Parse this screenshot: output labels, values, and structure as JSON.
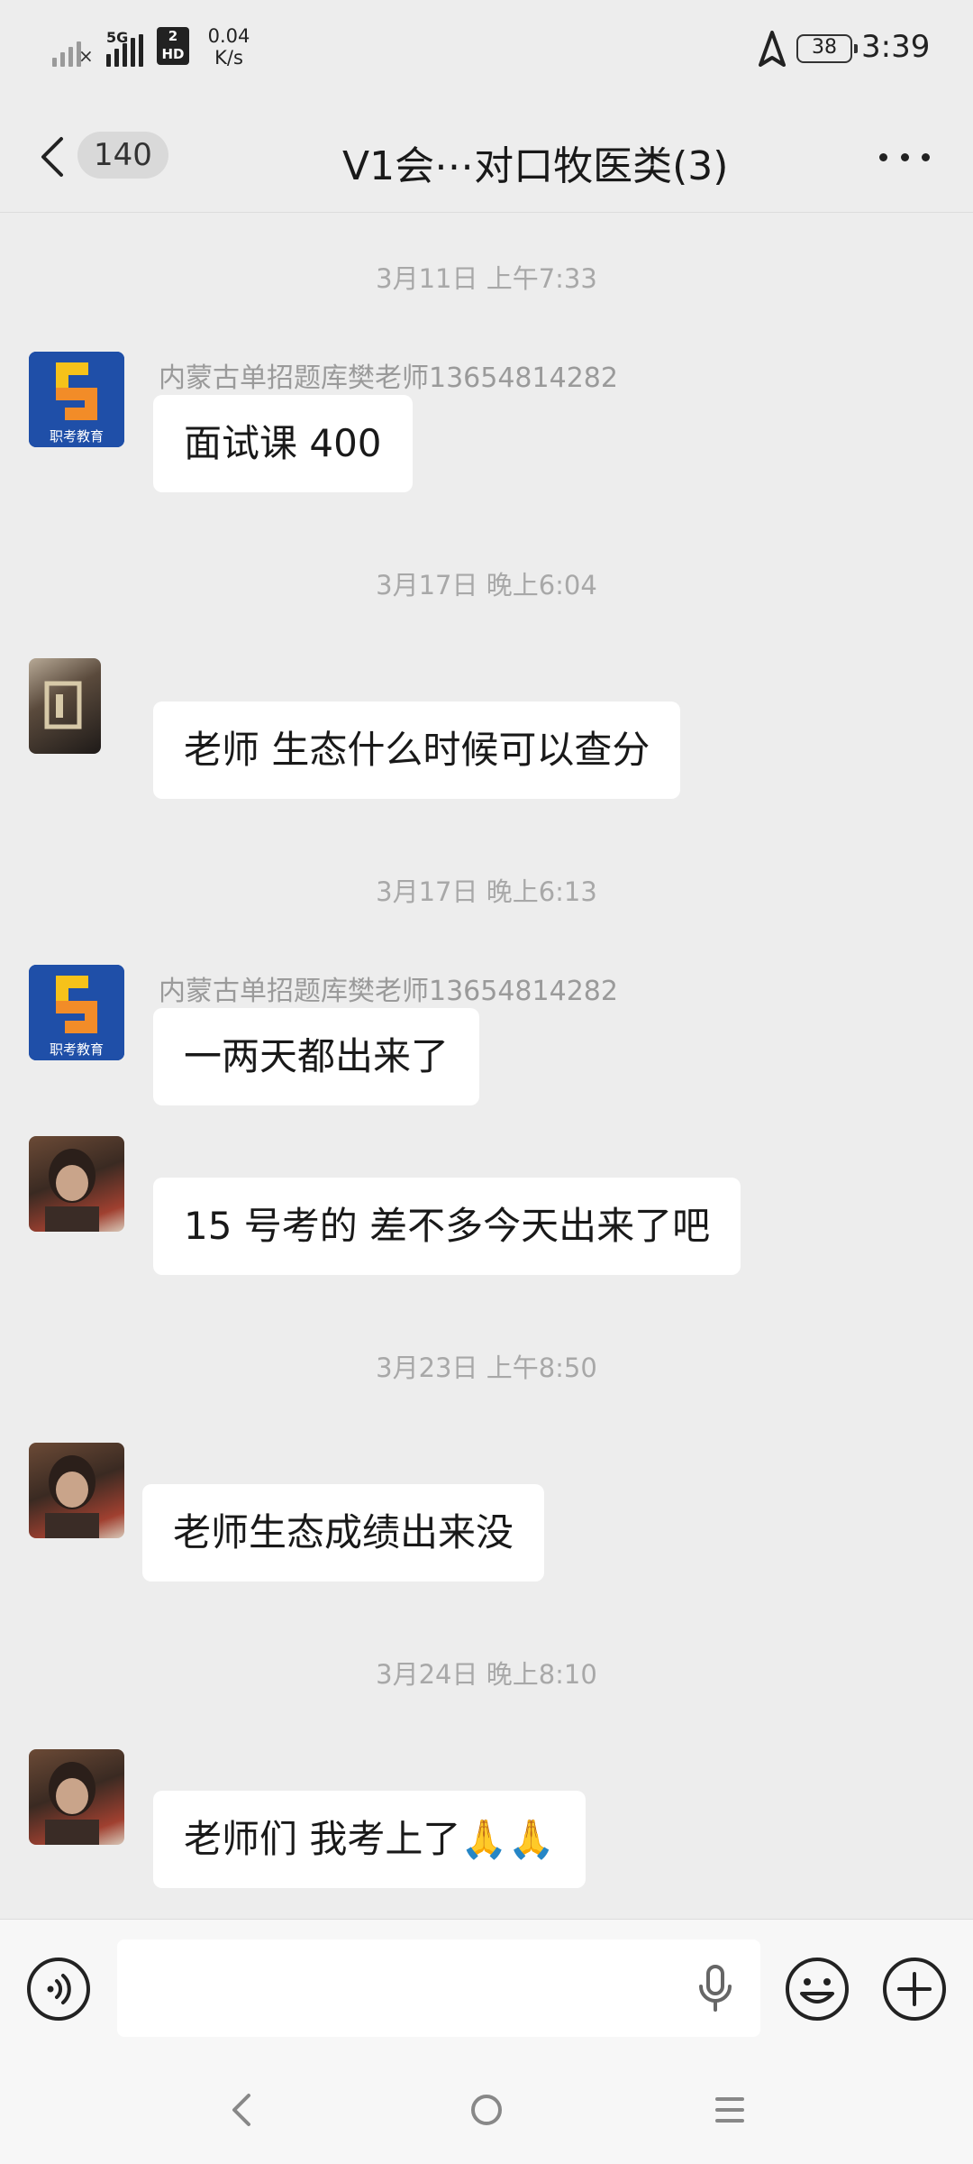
{
  "status_bar": {
    "network": "5G",
    "hd_top": "2",
    "hd_bottom": "HD",
    "speed_value": "0.04",
    "speed_unit": "K/s",
    "battery": "38",
    "time": "3:39"
  },
  "header": {
    "unread_count": "140",
    "title": "V1会⋯对口牧医类(3)"
  },
  "messages": [
    {
      "timestamp": "3月11日 上午7:33",
      "sender": "内蒙古单招题库樊老师13654814282",
      "avatar": "zhikao-logo",
      "text": "面试课 400"
    },
    {
      "timestamp": "3月17日 晚上6:04",
      "sender": "",
      "avatar": "dark-photo",
      "text": "老师  生态什么时候可以查分"
    },
    {
      "timestamp": "3月17日 晚上6:13",
      "sender": "内蒙古单招题库樊老师13654814282",
      "avatar": "zhikao-logo",
      "text": "一两天都出来了"
    },
    {
      "timestamp": "",
      "sender": "",
      "avatar": "portrait-photo",
      "text": "15 号考的  差不多今天出来了吧"
    },
    {
      "timestamp": "3月23日 上午8:50",
      "sender": "",
      "avatar": "portrait-photo",
      "text": "老师生态成绩出来没"
    },
    {
      "timestamp": "3月24日 晚上8:10",
      "sender": "",
      "avatar": "portrait-photo",
      "text": "老师们  我考上了🙏🙏"
    }
  ],
  "logo_text": "职考教育",
  "icons": [
    "voice-input-icon",
    "microphone-icon",
    "emoji-icon",
    "plus-icon",
    "back-arrow-icon",
    "more-icon",
    "navigation-arrow-icon"
  ]
}
